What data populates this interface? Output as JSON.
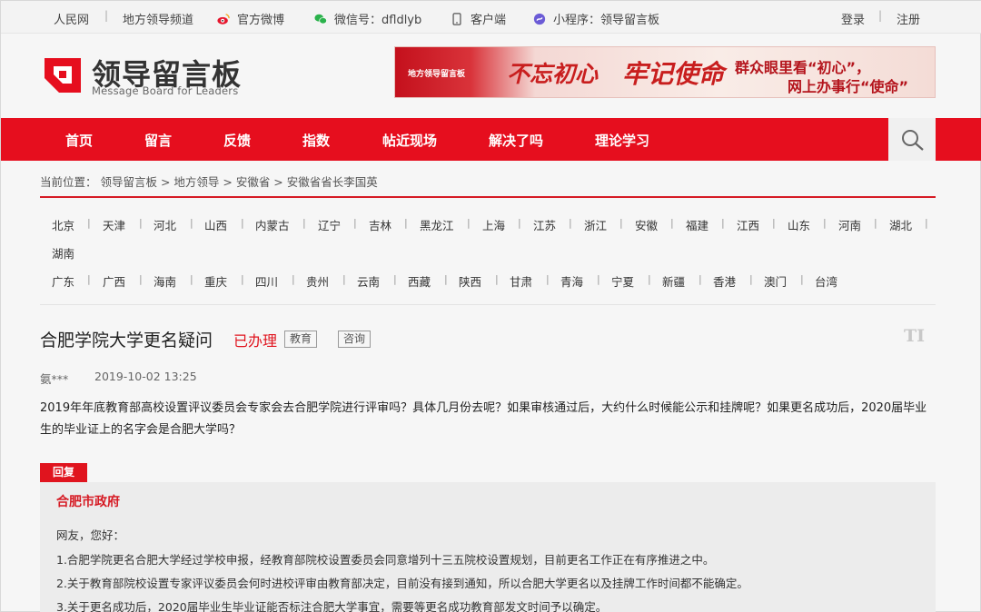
{
  "topbar": {
    "left": [
      {
        "label": "人民网"
      },
      {
        "label": "地方领导频道"
      },
      {
        "label": "官方微博",
        "icon": "weibo-icon"
      },
      {
        "label": "微信号：dfldlyb",
        "icon": "wechat-icon"
      },
      {
        "label": "客户端",
        "icon": "phone-icon"
      },
      {
        "label": "小程序：领导留言板",
        "icon": "miniprogram-icon"
      }
    ],
    "login": "登录",
    "register": "注册"
  },
  "header": {
    "logo_cn": "领导留言板",
    "logo_en": "Message Board for Leaders",
    "banner": {
      "tag": "地方领导留言板",
      "script1": "不忘初心",
      "script2": "牢记使命",
      "line1": "群众眼里看“初心”，",
      "line2": "网上办事行“使命”"
    }
  },
  "nav": {
    "items": [
      "首页",
      "留言",
      "反馈",
      "指数",
      "帖近现场",
      "解决了吗",
      "理论学习"
    ],
    "search_icon": "search-icon"
  },
  "breadcrumb": "当前位置：  领导留言板 > 地方领导 > 安徽省 > 安徽省省长李国英",
  "provinces": {
    "row1": [
      "北京",
      "天津",
      "河北",
      "山西",
      "内蒙古",
      "辽宁",
      "吉林",
      "黑龙江",
      "上海",
      "江苏",
      "浙江",
      "安徽",
      "福建",
      "江西",
      "山东",
      "河南",
      "湖北"
    ],
    "row2": [
      "湖南"
    ],
    "row3": [
      "广东",
      "广西",
      "海南",
      "重庆",
      "四川",
      "贵州",
      "云南",
      "西藏",
      "陕西",
      "甘肃",
      "青海",
      "宁夏",
      "新疆",
      "香港",
      "澳门",
      "台湾"
    ]
  },
  "article": {
    "title": "合肥学院大学更名疑问",
    "status": "已办理",
    "tags": [
      "教育",
      "咨询"
    ],
    "ti_icon": "TI",
    "author": "氨***",
    "date": "2019-10-02 13:25",
    "content": "2019年年底教育部高校设置评议委员会专家会去合肥学院进行评审吗？具体几月份去呢？如果审核通过后，大约什么时候能公示和挂牌呢？如果更名成功后，2020届毕业生的毕业证上的名字会是合肥大学吗？"
  },
  "reply": {
    "badge": "回复",
    "org": "合肥市政府",
    "lines": [
      "网友，您好：",
      "1.合肥学院更名合肥大学经过学校申报，经教育部院校设置委员会同意增列十三五院校设置规划，目前更名工作正在有序推进之中。",
      "2.关于教育部院校设置专家评议委员会何时进校评审由教育部决定，目前没有接到通知，所以合肥大学更名以及挂牌工作时间都不能确定。",
      "3.关于更名成功后，2020届毕业生毕业证能否标注合肥大学事宜，需要等更名成功教育部发文时间予以确定。"
    ]
  },
  "colors": {
    "brand_red": "#e60e1e",
    "status_red": "#e0141e"
  }
}
